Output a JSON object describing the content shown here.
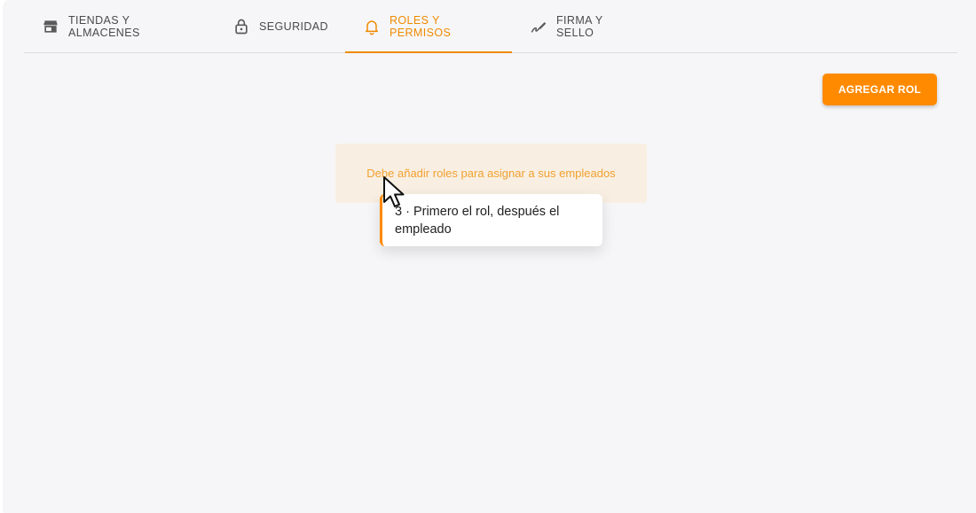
{
  "tabs": [
    {
      "label": "TIENDAS Y ALMACENES",
      "icon": "store-icon",
      "active": false
    },
    {
      "label": "SEGURIDAD",
      "icon": "lock-icon",
      "active": false
    },
    {
      "label": "ROLES Y PERMISOS",
      "icon": "bell-icon",
      "active": true
    },
    {
      "label": "FIRMA Y SELLO",
      "icon": "signature-icon",
      "active": false
    }
  ],
  "actions": {
    "add_role_label": "AGREGAR ROL"
  },
  "empty_state": {
    "message": "Debe añadir roles para asignar a sus empleados"
  },
  "tooltip": {
    "text": "3 · Primero el rol, después el empleado"
  },
  "colors": {
    "accent": "#ff8a00",
    "active_tab": "#f08a00",
    "alert_bg": "#f8efe2",
    "alert_text": "#f2a030",
    "panel_bg": "#f6f6f8"
  }
}
